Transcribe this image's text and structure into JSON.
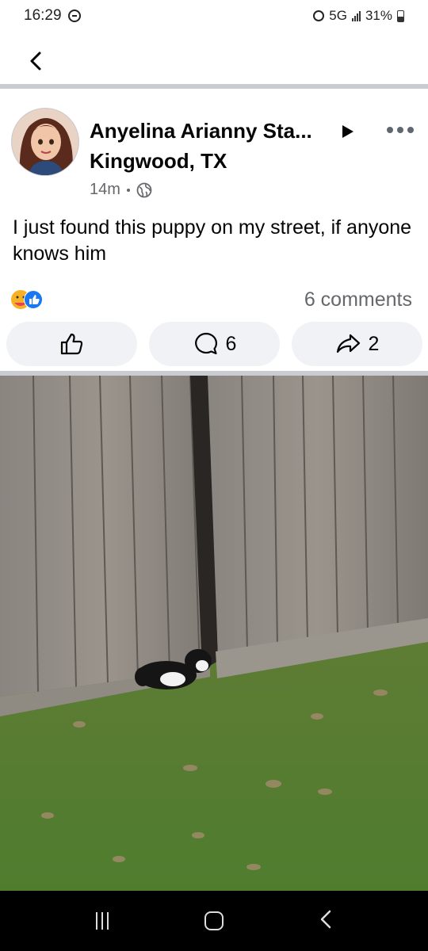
{
  "status_bar": {
    "time": "16:29",
    "network": "5G",
    "battery": "31%"
  },
  "post": {
    "author_name": "Anyelina Arianny Sta...",
    "location": "Kingwood, TX",
    "timestamp": "14m",
    "text": "I just found this puppy on my street, if anyone knows him",
    "comments_label": "6 comments",
    "actions": {
      "comment_count": "6",
      "share_count": "2"
    }
  },
  "icons": {
    "back": "chevron-left-icon",
    "more": "more-dots-icon",
    "privacy": "globe-icon",
    "like": "thumbs-up-icon",
    "comment": "comment-bubble-icon",
    "share": "share-arrow-icon"
  },
  "colors": {
    "secondary_text": "#65676b",
    "button_bg": "#f0f2f5",
    "divider": "#c9ccd1",
    "like_blue": "#1877f2",
    "care_yellow": "#f7b125"
  }
}
